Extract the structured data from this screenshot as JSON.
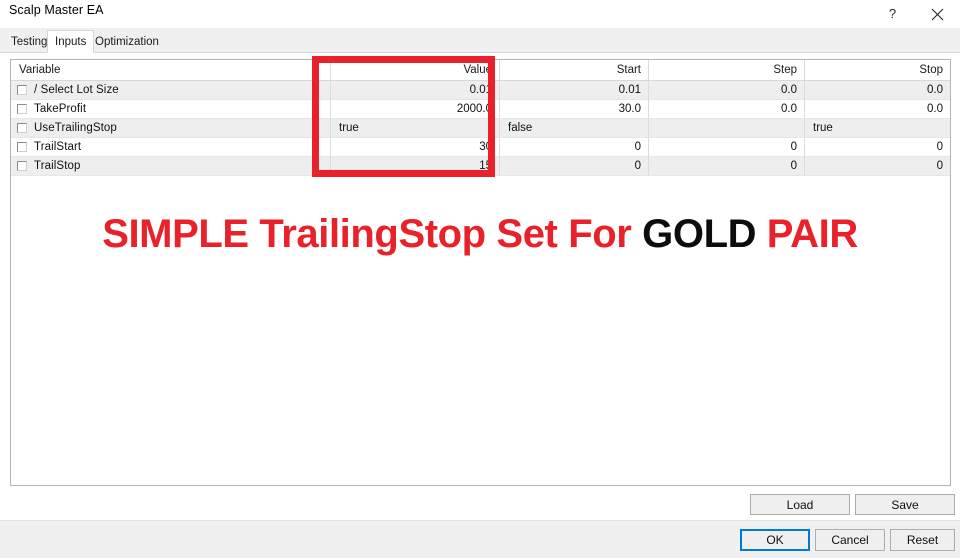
{
  "window": {
    "title": "Scalp Master EA",
    "help_icon": "question-mark-icon",
    "close_icon": "close-icon"
  },
  "tabs": [
    {
      "label": "Testing",
      "active": false
    },
    {
      "label": "Inputs",
      "active": true
    },
    {
      "label": "Optimization",
      "active": false
    }
  ],
  "table": {
    "headers": {
      "variable": "Variable",
      "value": "Value",
      "start": "Start",
      "step": "Step",
      "stop": "Stop"
    },
    "rows": [
      {
        "variable": "/ Select Lot Size",
        "checked": false,
        "value": "0.01",
        "start": "0.01",
        "step": "0.0",
        "stop": "0.0",
        "align": "num"
      },
      {
        "variable": "TakeProfit",
        "checked": false,
        "value": "2000.0",
        "start": "30.0",
        "step": "0.0",
        "stop": "0.0",
        "align": "num"
      },
      {
        "variable": "UseTrailingStop",
        "checked": false,
        "value": "true",
        "start": "false",
        "step": "",
        "stop": "true",
        "align": "txt"
      },
      {
        "variable": "TrailStart",
        "checked": false,
        "value": "30",
        "start": "0",
        "step": "0",
        "stop": "0",
        "align": "num"
      },
      {
        "variable": "TrailStop",
        "checked": false,
        "value": "15",
        "start": "0",
        "step": "0",
        "stop": "0",
        "align": "num"
      }
    ]
  },
  "annotation": {
    "highlight_color": "#e8212a",
    "headline_part1": "SIMPLE TrailingStop Set For ",
    "headline_part2": "GOLD",
    "headline_part3": " PAIR"
  },
  "footer": {
    "load": "Load",
    "save": "Save",
    "ok": "OK",
    "cancel": "Cancel",
    "reset": "Reset"
  }
}
